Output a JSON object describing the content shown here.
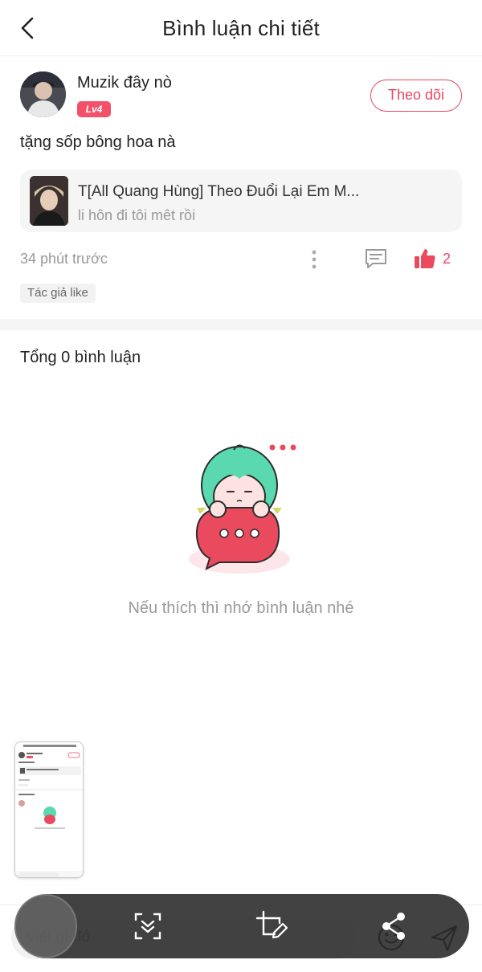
{
  "header": {
    "title": "Bình luận chi tiết"
  },
  "post": {
    "username": "Muzik đây nò",
    "level": "Lv4",
    "follow_label": "Theo dõi",
    "text": "tặng sốp bông hoa nà",
    "song": {
      "title": "T[All Quang Hùng] Theo Đuổi Lại Em M...",
      "subtitle": "li hôn đi tôi mêt rồi"
    },
    "time_ago": "34 phút trước",
    "like_count": "2",
    "author_like_tag": "Tác giả like"
  },
  "comments": {
    "total_label": "Tổng 0 bình luận",
    "empty_text": "Nếu thích thì nhớ bình luận nhé"
  },
  "composer": {
    "placeholder": "Viết gì đó"
  },
  "colors": {
    "accent": "#e5485f",
    "badge": "#f3516a",
    "muted_text": "#999999",
    "illustration_hair": "#5ad9b0",
    "illustration_bubble": "#ea4a5d"
  },
  "icons": {
    "back": "chevron-left-icon",
    "more": "more-vertical-icon",
    "comment": "comment-icon",
    "like": "thumbs-up-icon",
    "emoji": "emoji-icon",
    "send": "send-icon",
    "scroll_capture": "scroll-capture-icon",
    "edit": "edit-crop-icon",
    "share": "share-icon"
  }
}
